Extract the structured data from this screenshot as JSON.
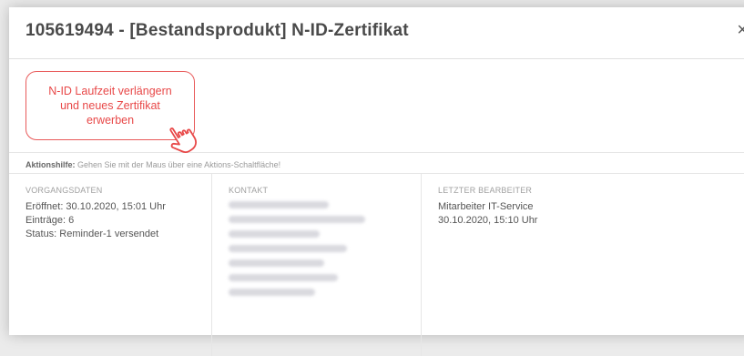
{
  "dialog": {
    "title": "105619494 - [Bestandsprodukt] N-ID-Zertifikat",
    "close_label": "×"
  },
  "action": {
    "button_label": "N-ID Laufzeit verlängern und neues Zertifikat erwerben",
    "hint_label": "Aktionshilfe:",
    "hint_text": "Gehen Sie mit der Maus über eine Aktions-Schaltfläche!"
  },
  "columns": {
    "vorgang": {
      "heading": "VORGANGSDATEN",
      "lines": [
        "Eröffnet: 30.10.2020, 15:01 Uhr",
        "Einträge: 6",
        "Status: Reminder-1 versendet"
      ]
    },
    "kontakt": {
      "heading": "KONTAKT"
    },
    "bearbeiter": {
      "heading": "LETZTER BEARBEITER",
      "lines": [
        "Mitarbeiter IT-Service",
        "30.10.2020, 15:10 Uhr"
      ]
    }
  },
  "colors": {
    "accent": "#e84848",
    "title_text": "#4a4a4a",
    "muted": "#9a9a9a"
  },
  "icons": [
    "close-icon",
    "pointer-cursor-icon"
  ]
}
